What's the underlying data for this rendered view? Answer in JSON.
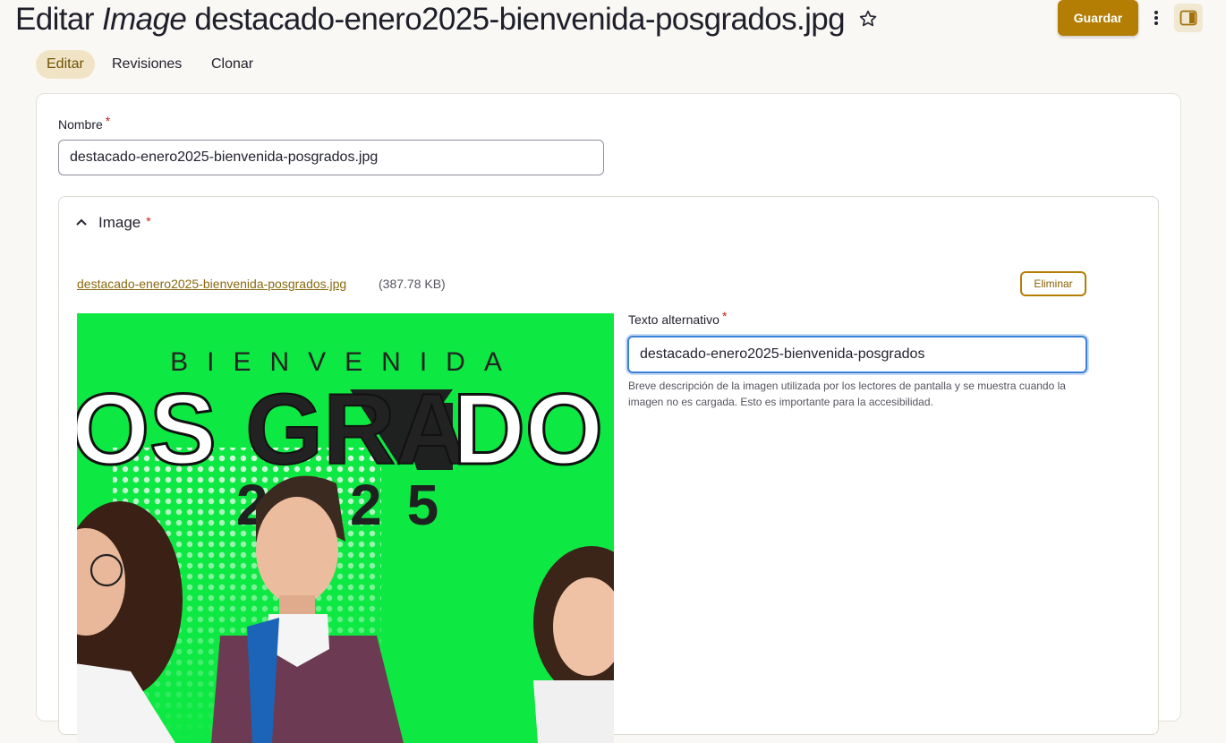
{
  "header": {
    "title_prefix": "Editar",
    "title_type": "Image",
    "title_name": "destacado-enero2025-bienvenida-posgrados.jpg",
    "save_label": "Guardar"
  },
  "tabs": [
    {
      "label": "Editar",
      "active": true
    },
    {
      "label": "Revisiones",
      "active": false
    },
    {
      "label": "Clonar",
      "active": false
    }
  ],
  "form": {
    "name_label": "Nombre",
    "name_value": "destacado-enero2025-bienvenida-posgrados.jpg",
    "required_mark": "*",
    "image_section": {
      "summary_label": "Image",
      "file_name": "destacado-enero2025-bienvenida-posgrados.jpg",
      "file_size": "(387.78 KB)",
      "remove_label": "Eliminar",
      "preview_text": {
        "line1": "BIENVENIDA",
        "line2_left": "OS",
        "line2_mid": "GRA",
        "line2_right": "DO",
        "line3": "2025"
      },
      "alt_label": "Texto alternativo",
      "alt_value": "destacado-enero2025-bienvenida-posgrados",
      "alt_description": "Breve descripción de la imagen utilizada por los lectores de pantalla y se muestra cuando la imagen no es cargada. Esto es importante para la accesibilidad."
    }
  },
  "colors": {
    "accent": "#b47e05",
    "required": "#c0231b",
    "focus": "#3a7fd8",
    "preview_green": "#0ee843"
  }
}
